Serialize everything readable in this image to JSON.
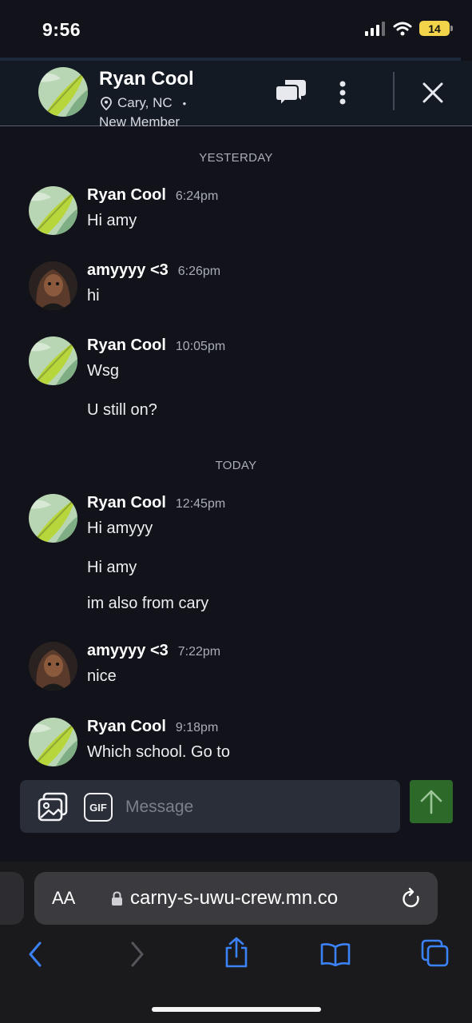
{
  "status_bar": {
    "time": "9:56",
    "battery": "14"
  },
  "header": {
    "name": "Ryan Cool",
    "location": "Cary, NC",
    "dot": "•",
    "member": "New Member"
  },
  "days": {
    "yesterday": "YESTERDAY",
    "today": "TODAY"
  },
  "messages": [
    {
      "name": "Ryan Cool",
      "time": "6:24pm",
      "lines": [
        "Hi amy"
      ]
    },
    {
      "name": "amyyyy <3",
      "time": "6:26pm",
      "lines": [
        "hi"
      ]
    },
    {
      "name": "Ryan Cool",
      "time": "10:05pm",
      "lines": [
        "Wsg",
        "U still on?"
      ]
    },
    {
      "name": "Ryan Cool",
      "time": "12:45pm",
      "lines": [
        "Hi amyyy",
        "Hi amy",
        "im also from cary"
      ]
    },
    {
      "name": "amyyyy <3",
      "time": "7:22pm",
      "lines": [
        "nice"
      ]
    },
    {
      "name": "Ryan Cool",
      "time": "9:18pm",
      "lines": [
        "Which school. Go to"
      ]
    }
  ],
  "composer": {
    "gif_label": "GIF",
    "placeholder": "Message"
  },
  "browser": {
    "aa": "AA",
    "url": "carny-s-uwu-crew.mn.co"
  },
  "colors": {
    "background": "#12131a",
    "send": "#2d6a2a",
    "ios_blue": "#3b82f6"
  }
}
